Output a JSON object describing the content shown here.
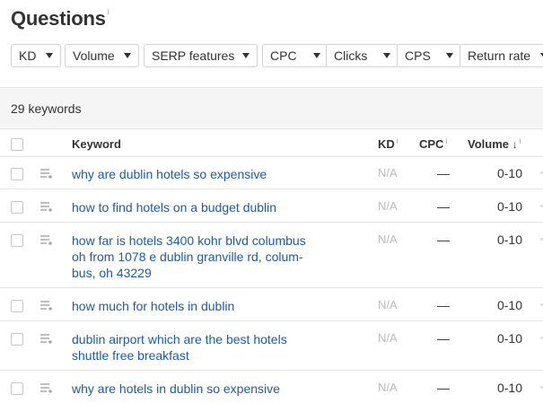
{
  "page": {
    "title": "Questions",
    "title_info": "i"
  },
  "filters": [
    {
      "label": "KD"
    },
    {
      "label": "Volume"
    },
    {
      "label": "SERP features"
    },
    {
      "label": "CPC"
    },
    {
      "label": "Clicks"
    },
    {
      "label": "CPS"
    },
    {
      "label": "Return rate"
    }
  ],
  "summary": {
    "count_text": "29 keywords"
  },
  "table": {
    "headers": {
      "keyword": "Keyword",
      "kd": "KD",
      "cpc": "CPC",
      "volume": "Volume",
      "info": "i",
      "sort_arrow": "↓"
    },
    "rows": [
      {
        "keyword": "why are dublin hotels so expensive",
        "kd": "N/A",
        "cpc": "—",
        "volume": "0-10"
      },
      {
        "keyword": "how to find hotels on a budget dublin",
        "kd": "N/A",
        "cpc": "—",
        "volume": "0-10"
      },
      {
        "keyword": "how far is hotels 3400 kohr blvd columbus oh from 1078 e dublin granville rd, colum-bus, oh 43229",
        "kd": "N/A",
        "cpc": "—",
        "volume": "0-10"
      },
      {
        "keyword": "how much for hotels in dublin",
        "kd": "N/A",
        "cpc": "—",
        "volume": "0-10"
      },
      {
        "keyword": "dublin airport which are the best hotels shuttle free breakfast",
        "kd": "N/A",
        "cpc": "—",
        "volume": "0-10"
      },
      {
        "keyword": "why are hotels in dublin so expensive",
        "kd": "N/A",
        "cpc": "—",
        "volume": "0-10"
      }
    ]
  },
  "colors": {
    "link": "#1f5aa8",
    "muted": "#bbbbbb",
    "band": "#f5f5f5"
  }
}
